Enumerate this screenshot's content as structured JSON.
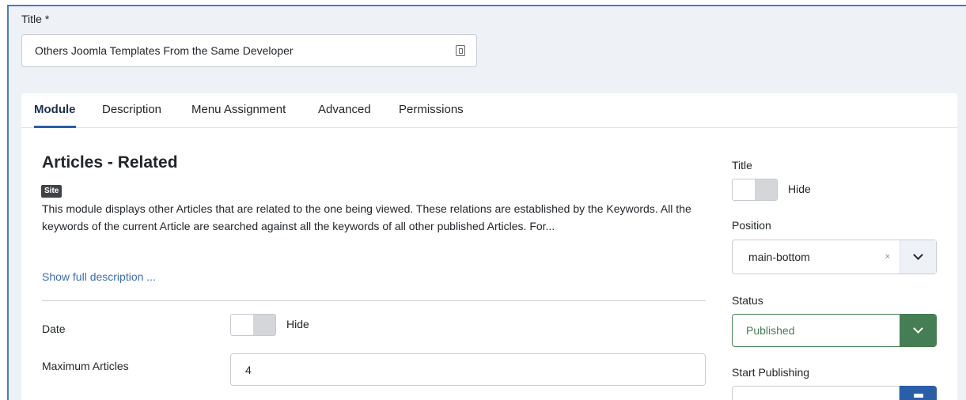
{
  "title_field": {
    "label": "Title *",
    "value": "Others Joomla Templates From the Same Developer"
  },
  "tabs": [
    {
      "label": "Module",
      "active": true
    },
    {
      "label": "Description",
      "active": false
    },
    {
      "label": "Menu Assignment",
      "active": false
    },
    {
      "label": "Advanced",
      "active": false
    },
    {
      "label": "Permissions",
      "active": false
    }
  ],
  "module": {
    "name": "Articles - Related",
    "badge": "Site",
    "description": "This module displays other Articles that are related to the one being viewed. These relations are established by the Keywords. All the keywords of the current Article are searched against all the keywords of all other published Articles. For...",
    "show_full": "Show full description ..."
  },
  "fields": {
    "date": {
      "label": "Date",
      "state": "Hide"
    },
    "max_articles": {
      "label": "Maximum Articles",
      "value": "4"
    }
  },
  "side": {
    "title": {
      "label": "Title",
      "state": "Hide"
    },
    "position": {
      "label": "Position",
      "value": "main-bottom",
      "clear": "×"
    },
    "status": {
      "label": "Status",
      "value": "Published"
    },
    "start_publishing": {
      "label": "Start Publishing",
      "value": ""
    }
  },
  "colors": {
    "accent": "#2a5ea8",
    "status_green": "#457d54",
    "link": "#3f6db3",
    "frame_border": "#4a7ac8",
    "background": "#eef2f7"
  },
  "icons": {
    "title_field": "lock-icon",
    "dropdown": "chevron-down-icon",
    "date_picker": "calendar-icon"
  }
}
